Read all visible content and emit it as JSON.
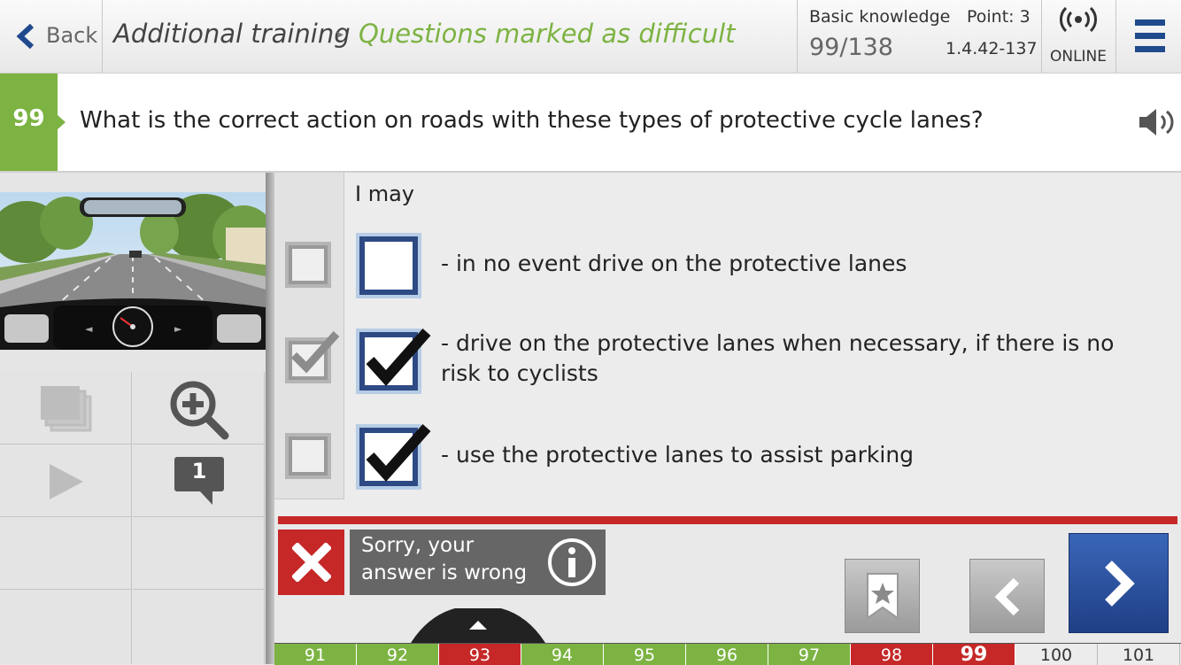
{
  "header": {
    "back_label": "Back",
    "breadcrumb_parent": "Additional training",
    "breadcrumb_separator": "▸",
    "breadcrumb_current": "Questions marked as difficult",
    "category": "Basic knowledge",
    "points": "Point: 3",
    "progress": "99/138",
    "question_id": "1.4.42-137",
    "status": "ONLINE"
  },
  "question": {
    "number": "99",
    "text": "What is the correct action on roads with these types of protective cycle lanes?"
  },
  "answers": {
    "intro": "I may",
    "items": [
      {
        "text": "- in no event drive on the protective lanes",
        "correct": false,
        "user_checked": false
      },
      {
        "text": "- drive on the protective lanes when necessary, if there is no risk to cyclists",
        "correct": true,
        "user_checked": true
      },
      {
        "text": "- use the protective lanes to assist parking",
        "correct": false,
        "user_checked": true
      }
    ]
  },
  "tools": {
    "comment_count": "1"
  },
  "feedback": {
    "line1": "Sorry, your",
    "line2": "answer is wrong"
  },
  "pagination": [
    {
      "label": "91",
      "state": "ok"
    },
    {
      "label": "92",
      "state": "ok"
    },
    {
      "label": "93",
      "state": "bad"
    },
    {
      "label": "94",
      "state": "ok"
    },
    {
      "label": "95",
      "state": "ok"
    },
    {
      "label": "96",
      "state": "ok"
    },
    {
      "label": "97",
      "state": "ok"
    },
    {
      "label": "98",
      "state": "bad"
    },
    {
      "label": "99",
      "state": "current"
    },
    {
      "label": "100",
      "state": "open"
    },
    {
      "label": "101",
      "state": "open"
    }
  ],
  "colors": {
    "accent_green": "#7cb342",
    "error_red": "#c62828",
    "brand_blue": "#1f4a8c"
  },
  "icons": [
    "back-chevron-icon",
    "online-signal-icon",
    "menu-icon",
    "speaker-icon",
    "copy-icon",
    "zoom-in-icon",
    "play-icon",
    "comment-icon",
    "close-x-icon",
    "info-icon",
    "bookmark-icon",
    "chevron-left-icon",
    "chevron-right-icon",
    "checkmark-icon"
  ]
}
